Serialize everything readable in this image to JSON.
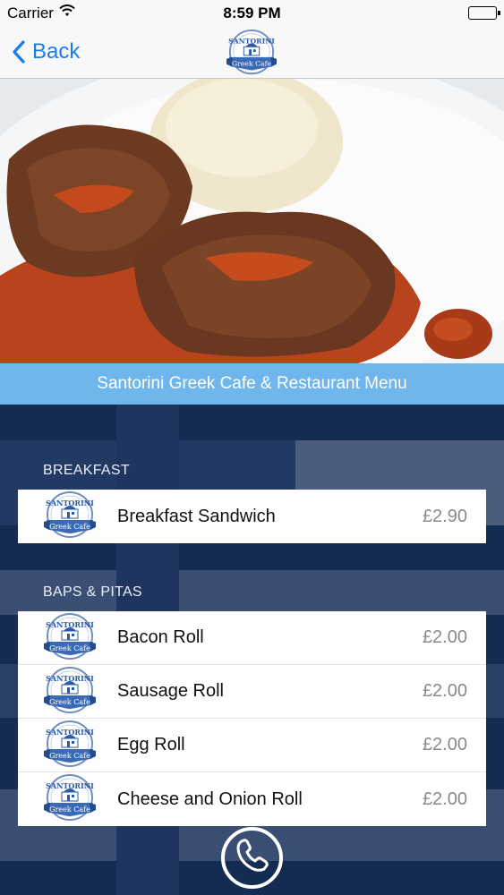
{
  "status_bar": {
    "carrier": "Carrier",
    "time": "8:59 PM",
    "wifi_icon": "wifi-icon",
    "battery_icon": "battery-icon"
  },
  "nav": {
    "back_label": "Back",
    "back_icon": "chevron-left-icon",
    "logo_icon": "santorini-greek-cafe-logo"
  },
  "logo_text": {
    "top": "SANTORINI",
    "bottom": "Greek Cafe"
  },
  "hero_image": "greek-stew-with-rice-photo",
  "menu_title": "Santorini Greek Cafe & Restaurant Menu",
  "sections": [
    {
      "title": "BREAKFAST",
      "items": [
        {
          "name": "Breakfast Sandwich",
          "price": "£2.90"
        }
      ]
    },
    {
      "title": "BAPS & PITAS",
      "items": [
        {
          "name": "Bacon Roll",
          "price": "£2.00"
        },
        {
          "name": "Sausage Roll",
          "price": "£2.00"
        },
        {
          "name": "Egg Roll",
          "price": "£2.00"
        },
        {
          "name": "Cheese and Onion Roll",
          "price": "£2.00"
        }
      ]
    }
  ],
  "call_icon": "phone-icon",
  "colors": {
    "accent": "#1a7bf2",
    "banner": "#6fb6ec",
    "background": "#142b52",
    "logo_blue": "#2a5aa8"
  }
}
